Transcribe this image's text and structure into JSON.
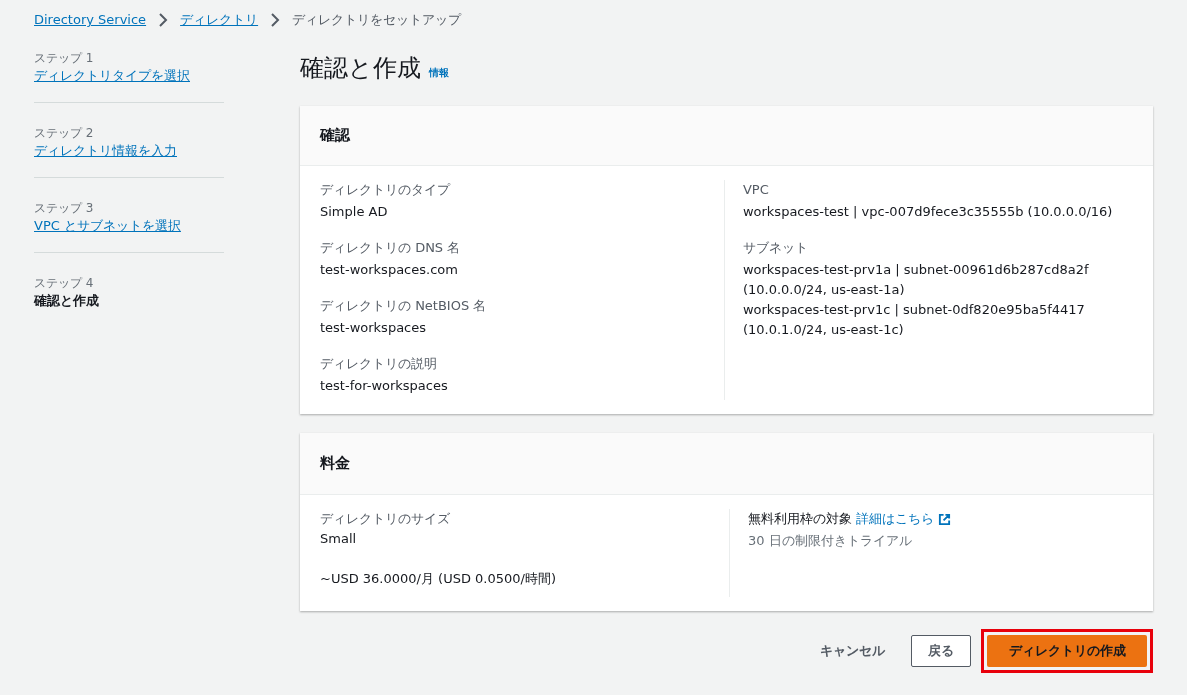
{
  "breadcrumb": [
    {
      "label": "Directory Service",
      "link": true
    },
    {
      "label": "ディレクトリ",
      "link": true
    },
    {
      "label": "ディレクトリをセットアップ",
      "link": false
    }
  ],
  "steps": [
    {
      "step": "ステップ 1",
      "label": "ディレクトリタイプを選択",
      "selected": false
    },
    {
      "step": "ステップ 2",
      "label": "ディレクトリ情報を入力",
      "selected": false
    },
    {
      "step": "ステップ 3",
      "label": "VPC とサブネットを選択",
      "selected": false
    },
    {
      "step": "ステップ 4",
      "label": "確認と作成",
      "selected": true
    }
  ],
  "page_title": "確認と作成",
  "info_link": "情報",
  "review": {
    "title": "確認",
    "left": [
      {
        "label": "ディレクトリのタイプ",
        "values": [
          "Simple AD"
        ]
      },
      {
        "label": "ディレクトリの DNS 名",
        "values": [
          "test-workspaces.com"
        ]
      },
      {
        "label": "ディレクトリの NetBIOS 名",
        "values": [
          "test-workspaces"
        ]
      },
      {
        "label": "ディレクトリの説明",
        "values": [
          "test-for-workspaces"
        ]
      }
    ],
    "right": [
      {
        "label": "VPC",
        "values": [
          "workspaces-test | vpc-007d9fece3c35555b (10.0.0.0/16)"
        ]
      },
      {
        "label": "サブネット",
        "values": [
          "workspaces-test-prv1a | subnet-00961d6b287cd8a2f (10.0.0.0/24, us-east-1a)",
          "workspaces-test-prv1c | subnet-0df820e95ba5f4417 (10.0.1.0/24, us-east-1c)"
        ]
      }
    ]
  },
  "pricing": {
    "title": "料金",
    "size_label": "ディレクトリのサイズ",
    "size_value": "Small",
    "price": "~USD 36.0000/月 (USD 0.0500/時間)",
    "free_tier_label": "無料利用枠の対象",
    "free_tier_link": "詳細はこちら",
    "trial": "30 日の制限付きトライアル"
  },
  "buttons": [
    {
      "label": "キャンセル",
      "kind": "link",
      "highlighted": false
    },
    {
      "label": "戻る",
      "kind": "secondary",
      "highlighted": false
    },
    {
      "label": "ディレクトリの作成",
      "kind": "primary",
      "highlighted": true
    }
  ]
}
